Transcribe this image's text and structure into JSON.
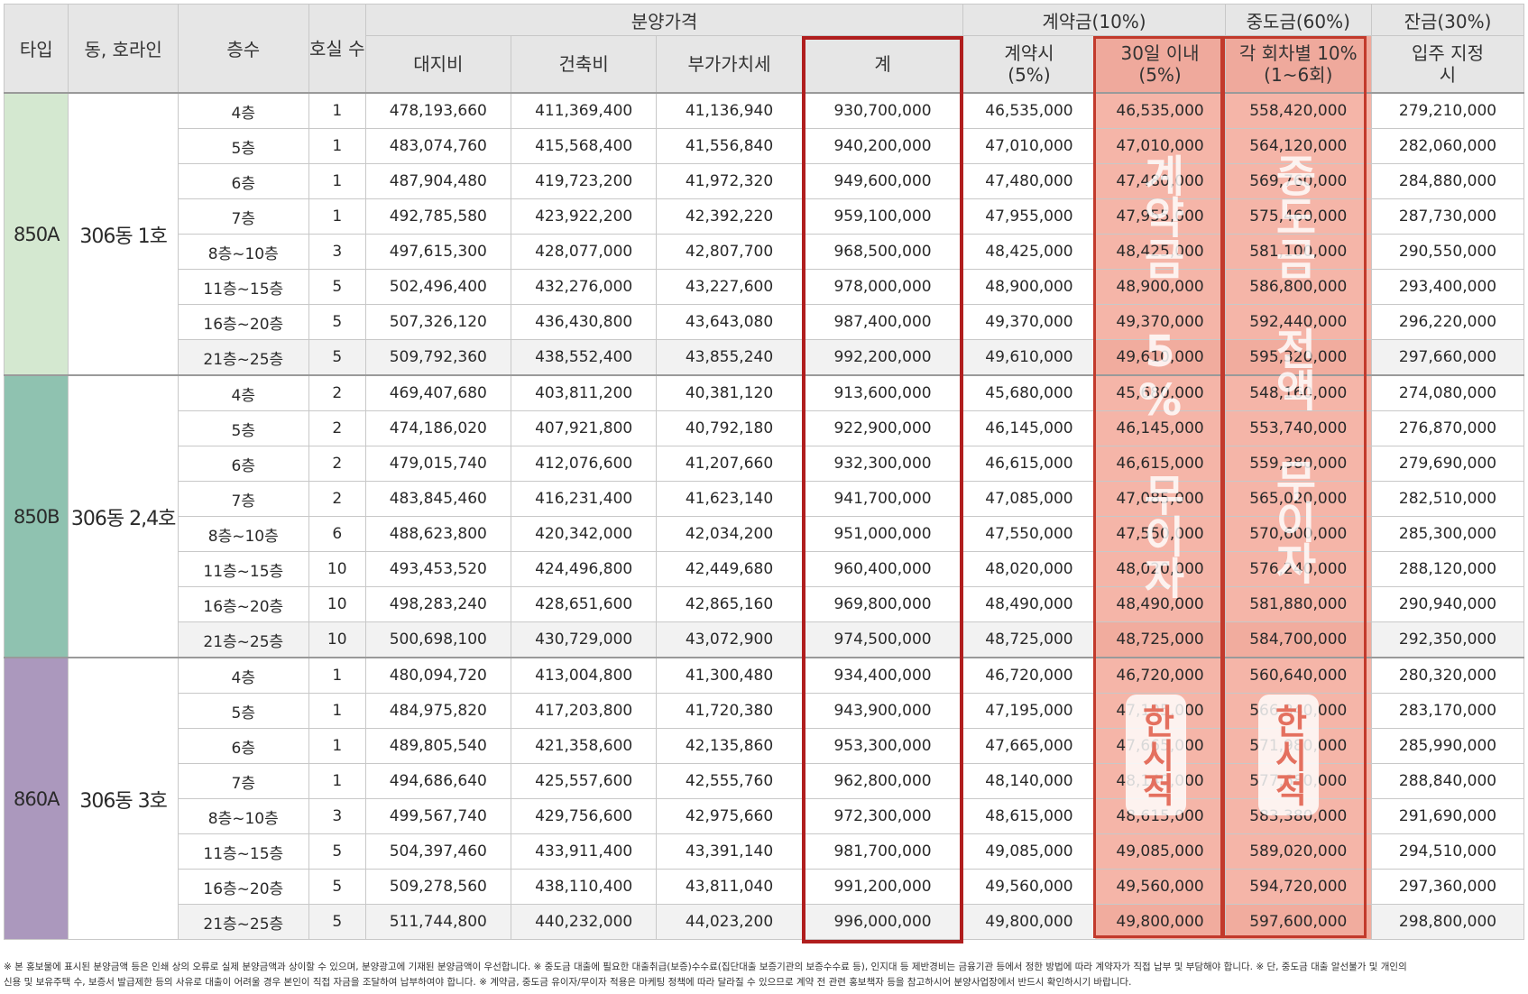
{
  "headers": {
    "type": "타입",
    "dong_line": "동, 호라인",
    "floor": "층수",
    "units": "호실 수",
    "sale_price": "분양가격",
    "land": "대지비",
    "building": "건축비",
    "vat": "부가가치세",
    "total": "계",
    "deposit": "계약금(10%)",
    "deposit_at_contract": "계약시 (5%)",
    "deposit_within_30": "30일 이내 (5%)",
    "middle": "중도금(60%)",
    "middle_detail": "각 회차별 10% (1~6회)",
    "balance": "잔금(30%)",
    "balance_detail": "입주 지정시"
  },
  "groups": [
    {
      "type": "850A",
      "type_color": "#d4e8d0",
      "dong": "306동 1호",
      "rows": [
        {
          "floor": "4층",
          "units": "1",
          "land": "478,193,660",
          "building": "411,369,400",
          "vat": "41,136,940",
          "total": "930,700,000",
          "d1": "46,535,000",
          "d2": "46,535,000",
          "mid": "558,420,000",
          "bal": "279,210,000"
        },
        {
          "floor": "5층",
          "units": "1",
          "land": "483,074,760",
          "building": "415,568,400",
          "vat": "41,556,840",
          "total": "940,200,000",
          "d1": "47,010,000",
          "d2": "47,010,000",
          "mid": "564,120,000",
          "bal": "282,060,000"
        },
        {
          "floor": "6층",
          "units": "1",
          "land": "487,904,480",
          "building": "419,723,200",
          "vat": "41,972,320",
          "total": "949,600,000",
          "d1": "47,480,000",
          "d2": "47,480,000",
          "mid": "569,760,000",
          "bal": "284,880,000"
        },
        {
          "floor": "7층",
          "units": "1",
          "land": "492,785,580",
          "building": "423,922,200",
          "vat": "42,392,220",
          "total": "959,100,000",
          "d1": "47,955,000",
          "d2": "47,955,000",
          "mid": "575,460,000",
          "bal": "287,730,000"
        },
        {
          "floor": "8층~10층",
          "units": "3",
          "land": "497,615,300",
          "building": "428,077,000",
          "vat": "42,807,700",
          "total": "968,500,000",
          "d1": "48,425,000",
          "d2": "48,425,000",
          "mid": "581,100,000",
          "bal": "290,550,000"
        },
        {
          "floor": "11층~15층",
          "units": "5",
          "land": "502,496,400",
          "building": "432,276,000",
          "vat": "43,227,600",
          "total": "978,000,000",
          "d1": "48,900,000",
          "d2": "48,900,000",
          "mid": "586,800,000",
          "bal": "293,400,000"
        },
        {
          "floor": "16층~20층",
          "units": "5",
          "land": "507,326,120",
          "building": "436,430,800",
          "vat": "43,643,080",
          "total": "987,400,000",
          "d1": "49,370,000",
          "d2": "49,370,000",
          "mid": "592,440,000",
          "bal": "296,220,000"
        },
        {
          "floor": "21층~25층",
          "units": "5",
          "land": "509,792,360",
          "building": "438,552,400",
          "vat": "43,855,240",
          "total": "992,200,000",
          "d1": "49,610,000",
          "d2": "49,610,000",
          "mid": "595,320,000",
          "bal": "297,660,000"
        }
      ]
    },
    {
      "type": "850B",
      "type_color": "#8fc2b0",
      "dong": "306동 2,4호",
      "rows": [
        {
          "floor": "4층",
          "units": "2",
          "land": "469,407,680",
          "building": "403,811,200",
          "vat": "40,381,120",
          "total": "913,600,000",
          "d1": "45,680,000",
          "d2": "45,680,000",
          "mid": "548,160,000",
          "bal": "274,080,000"
        },
        {
          "floor": "5층",
          "units": "2",
          "land": "474,186,020",
          "building": "407,921,800",
          "vat": "40,792,180",
          "total": "922,900,000",
          "d1": "46,145,000",
          "d2": "46,145,000",
          "mid": "553,740,000",
          "bal": "276,870,000"
        },
        {
          "floor": "6층",
          "units": "2",
          "land": "479,015,740",
          "building": "412,076,600",
          "vat": "41,207,660",
          "total": "932,300,000",
          "d1": "46,615,000",
          "d2": "46,615,000",
          "mid": "559,380,000",
          "bal": "279,690,000"
        },
        {
          "floor": "7층",
          "units": "2",
          "land": "483,845,460",
          "building": "416,231,400",
          "vat": "41,623,140",
          "total": "941,700,000",
          "d1": "47,085,000",
          "d2": "47,085,000",
          "mid": "565,020,000",
          "bal": "282,510,000"
        },
        {
          "floor": "8층~10층",
          "units": "6",
          "land": "488,623,800",
          "building": "420,342,000",
          "vat": "42,034,200",
          "total": "951,000,000",
          "d1": "47,550,000",
          "d2": "47,550,000",
          "mid": "570,600,000",
          "bal": "285,300,000"
        },
        {
          "floor": "11층~15층",
          "units": "10",
          "land": "493,453,520",
          "building": "424,496,800",
          "vat": "42,449,680",
          "total": "960,400,000",
          "d1": "48,020,000",
          "d2": "48,020,000",
          "mid": "576,240,000",
          "bal": "288,120,000"
        },
        {
          "floor": "16층~20층",
          "units": "10",
          "land": "498,283,240",
          "building": "428,651,600",
          "vat": "42,865,160",
          "total": "969,800,000",
          "d1": "48,490,000",
          "d2": "48,490,000",
          "mid": "581,880,000",
          "bal": "290,940,000"
        },
        {
          "floor": "21층~25층",
          "units": "10",
          "land": "500,698,100",
          "building": "430,729,000",
          "vat": "43,072,900",
          "total": "974,500,000",
          "d1": "48,725,000",
          "d2": "48,725,000",
          "mid": "584,700,000",
          "bal": "292,350,000"
        }
      ]
    },
    {
      "type": "860A",
      "type_color": "#ab98bd",
      "dong": "306동 3호",
      "rows": [
        {
          "floor": "4층",
          "units": "1",
          "land": "480,094,720",
          "building": "413,004,800",
          "vat": "41,300,480",
          "total": "934,400,000",
          "d1": "46,720,000",
          "d2": "46,720,000",
          "mid": "560,640,000",
          "bal": "280,320,000"
        },
        {
          "floor": "5층",
          "units": "1",
          "land": "484,975,820",
          "building": "417,203,800",
          "vat": "41,720,380",
          "total": "943,900,000",
          "d1": "47,195,000",
          "d2": "47,195,000",
          "mid": "566,340,000",
          "bal": "283,170,000"
        },
        {
          "floor": "6층",
          "units": "1",
          "land": "489,805,540",
          "building": "421,358,600",
          "vat": "42,135,860",
          "total": "953,300,000",
          "d1": "47,665,000",
          "d2": "47,665,000",
          "mid": "571,980,000",
          "bal": "285,990,000"
        },
        {
          "floor": "7층",
          "units": "1",
          "land": "494,686,640",
          "building": "425,557,600",
          "vat": "42,555,760",
          "total": "962,800,000",
          "d1": "48,140,000",
          "d2": "48,140,000",
          "mid": "577,680,000",
          "bal": "288,840,000"
        },
        {
          "floor": "8층~10층",
          "units": "3",
          "land": "499,567,740",
          "building": "429,756,600",
          "vat": "42,975,660",
          "total": "972,300,000",
          "d1": "48,615,000",
          "d2": "48,615,000",
          "mid": "583,380,000",
          "bal": "291,690,000"
        },
        {
          "floor": "11층~15층",
          "units": "5",
          "land": "504,397,460",
          "building": "433,911,400",
          "vat": "43,391,140",
          "total": "981,700,000",
          "d1": "49,085,000",
          "d2": "49,085,000",
          "mid": "589,020,000",
          "bal": "294,510,000"
        },
        {
          "floor": "16층~20층",
          "units": "5",
          "land": "509,278,560",
          "building": "438,110,400",
          "vat": "43,811,040",
          "total": "991,200,000",
          "d1": "49,560,000",
          "d2": "49,560,000",
          "mid": "594,720,000",
          "bal": "297,360,000"
        },
        {
          "floor": "21층~25층",
          "units": "5",
          "land": "511,744,800",
          "building": "440,232,000",
          "vat": "44,023,200",
          "total": "996,000,000",
          "d1": "49,800,000",
          "d2": "49,800,000",
          "mid": "597,600,000",
          "bal": "298,800,000"
        }
      ]
    }
  ],
  "overlays": {
    "contract_text": "계약금 5% 무이자",
    "contract_badge": "한시적",
    "middle_text": "중도금 전액 무이자",
    "middle_badge": "한시적"
  },
  "footnote": {
    "line1": "※ 본 홍보물에 표시된 분양금액 등은 인쇄 상의 오류로 실제 분양금액과 상이할 수 있으며, 분양광고에 기재된 분양금액이 우선합니다. ※ 중도금 대출에 필요한 대출취급(보증)수수료(집단대출 보증기관의 보증수수료 등), 인지대 등 제반경비는 금융기관 등에서 정한 방법에 따라 계약자가 직접 납부 및 부담해야 합니다. ※ 단, 중도금 대출 알선불가 및 개인의",
    "line2": "신용 및 보유주택 수, 보증서 발급제한 등의 사유로 대출이 어려울 경우 본인이 직접 자금을 조달하여 납부하여야 합니다. ※ 계약금, 중도금 유이자/무이자 적용은 마케팅 정책에 따라 달라질 수 있으므로 계약 전 관련 홍보책자 등을 참고하시어 분양사업장에서 반드시 확인하시기 바랍니다."
  }
}
